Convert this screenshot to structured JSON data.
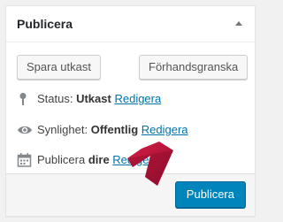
{
  "panel": {
    "title": "Publicera",
    "toggle_icon": "triangle-up-icon"
  },
  "actions": {
    "save_draft_label": "Spara utkast",
    "preview_label": "Förhandsgranska"
  },
  "status": {
    "icon": "pin-icon",
    "label": "Status:",
    "value": "Utkast",
    "edit_link": "Redigera"
  },
  "visibility": {
    "icon": "eye-icon",
    "label": "Synlighet:",
    "value": "Offentlig",
    "edit_link": "Redigera"
  },
  "publish_time": {
    "icon": "calendar-icon",
    "label": "Publicera",
    "value": "dire",
    "edit_link": "Redigera"
  },
  "publish_button_label": "Publicera",
  "colors": {
    "primary_button": "#0085ba",
    "link": "#0073aa",
    "arrow": "#c3173e"
  }
}
